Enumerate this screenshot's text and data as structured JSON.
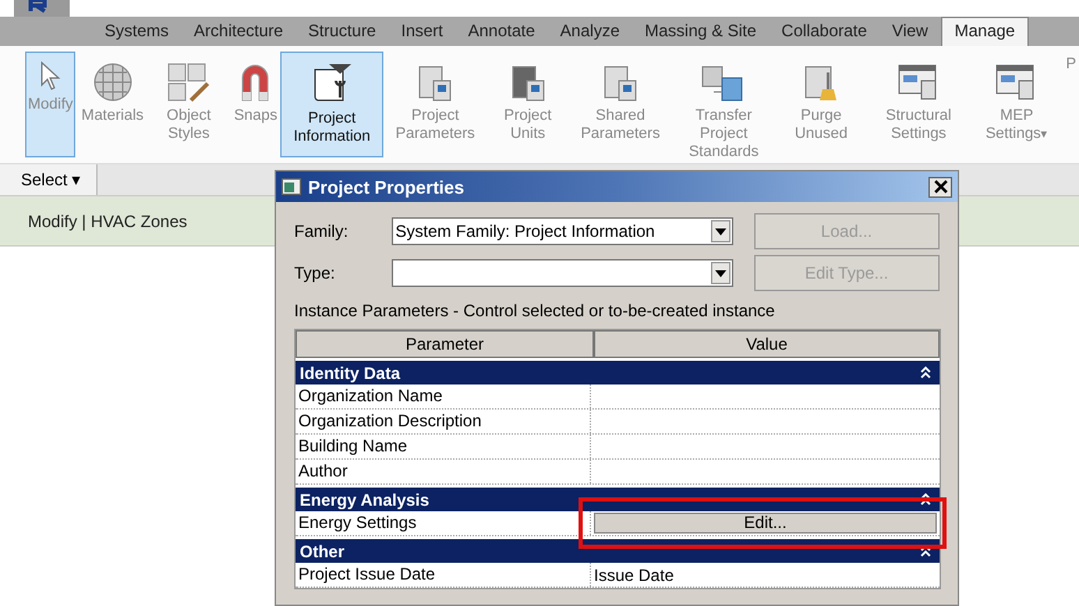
{
  "tabs": [
    {
      "label": "Systems",
      "selected": false
    },
    {
      "label": "Architecture",
      "selected": false
    },
    {
      "label": "Structure",
      "selected": false
    },
    {
      "label": "Insert",
      "selected": false
    },
    {
      "label": "Annotate",
      "selected": false
    },
    {
      "label": "Analyze",
      "selected": false
    },
    {
      "label": "Massing & Site",
      "selected": false
    },
    {
      "label": "Collaborate",
      "selected": false
    },
    {
      "label": "View",
      "selected": false
    },
    {
      "label": "Manage",
      "selected": true
    }
  ],
  "ribbon": {
    "items": [
      {
        "label": "Modify",
        "selected": true,
        "disabled": true
      },
      {
        "label": "Materials",
        "selected": false,
        "disabled": true
      },
      {
        "label": "Object Styles",
        "selected": false,
        "disabled": true
      },
      {
        "label": "Snaps",
        "selected": false,
        "disabled": true
      },
      {
        "label": "Project Information",
        "selected": true,
        "disabled": false
      },
      {
        "label": "Project Parameters",
        "selected": false,
        "disabled": true
      },
      {
        "label": "Project Units",
        "selected": false,
        "disabled": true
      },
      {
        "label": "Shared Parameters",
        "selected": false,
        "disabled": true
      },
      {
        "label": "Transfer Project Standards",
        "selected": false,
        "disabled": true
      },
      {
        "label": "Purge Unused",
        "selected": false,
        "disabled": true
      },
      {
        "label": "Structural Settings",
        "selected": false,
        "disabled": true
      },
      {
        "label": "MEP Settings",
        "selected": false,
        "disabled": true,
        "caret": "▾"
      },
      {
        "label": "P",
        "selected": false,
        "disabled": true
      }
    ]
  },
  "select_menu": {
    "label": "Select",
    "caret": "▾"
  },
  "context_bar": "Modify | HVAC Zones",
  "dialog": {
    "title": "Project Properties",
    "family": {
      "label": "Family:",
      "value": "System Family: Project Information"
    },
    "type": {
      "label": "Type:"
    },
    "buttons": [
      {
        "label": "Load...",
        "disabled": true
      },
      {
        "label": "Edit Type...",
        "disabled": true
      }
    ],
    "instance_caption": "Instance Parameters - Control selected or to-be-created instance",
    "columns": [
      "Parameter",
      "Value"
    ],
    "groups": [
      {
        "name": "Identity Data",
        "rows": [
          {
            "parameter": "Organization Name",
            "kind": "text",
            "highlighted": false
          },
          {
            "parameter": "Organization Description",
            "kind": "text",
            "highlighted": false
          },
          {
            "parameter": "Building Name",
            "kind": "text",
            "highlighted": false
          },
          {
            "parameter": "Author",
            "kind": "text",
            "highlighted": false
          }
        ]
      },
      {
        "name": "Energy Analysis",
        "rows": [
          {
            "parameter": "Energy Settings",
            "value": "Edit...",
            "kind": "button",
            "highlighted": true
          }
        ]
      },
      {
        "name": "Other",
        "rows": [
          {
            "parameter": "Project Issue Date",
            "value": "Issue Date",
            "kind": "text",
            "highlighted": false
          }
        ]
      }
    ]
  }
}
